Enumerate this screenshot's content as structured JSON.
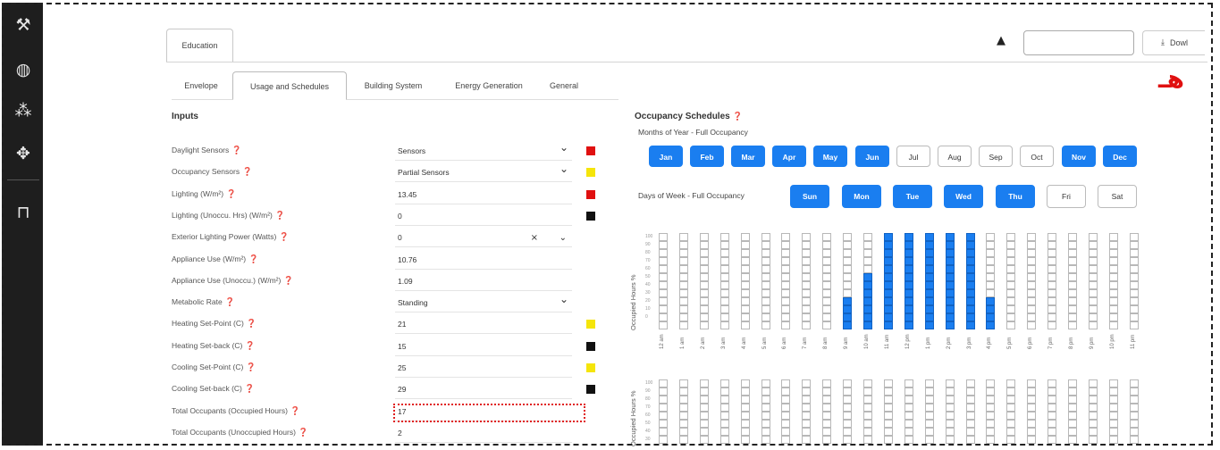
{
  "sidebar": {
    "icons": [
      "tool-icon",
      "globe-icon",
      "network-icon",
      "target-icon",
      "unlock-icon"
    ]
  },
  "top": {
    "tab_label": "Education",
    "search_value": "",
    "download_label": "Dowl",
    "annotation_mark": "هـ"
  },
  "subtabs": [
    {
      "label": "Envelope",
      "active": false
    },
    {
      "label": "Usage and Schedules",
      "active": true
    },
    {
      "label": "Building System",
      "active": false
    },
    {
      "label": "Energy Generation",
      "active": false
    },
    {
      "label": "General",
      "active": false
    }
  ],
  "inputs": {
    "title": "Inputs",
    "rows": [
      {
        "label": "Daylight Sensors",
        "value": "Sensors",
        "type": "select",
        "color": "#e01010"
      },
      {
        "label": "Occupancy Sensors",
        "value": "Partial Sensors",
        "type": "select",
        "color": "#f5e50a"
      },
      {
        "label": "Lighting (W/m²)",
        "value": "13.45",
        "type": "text",
        "color": "#e01010"
      },
      {
        "label": "Lighting (Unoccu. Hrs) (W/m²)",
        "value": "0",
        "type": "text",
        "color": "#111111"
      },
      {
        "label": "Exterior Lighting Power (Watts)",
        "value": "0",
        "type": "clearable",
        "color": ""
      },
      {
        "label": "Appliance Use (W/m²)",
        "value": "10.76",
        "type": "text",
        "color": ""
      },
      {
        "label": "Appliance Use (Unoccu.) (W/m²)",
        "value": "1.09",
        "type": "text",
        "color": ""
      },
      {
        "label": "Metabolic Rate",
        "value": "Standing",
        "type": "select",
        "color": ""
      },
      {
        "label": "Heating Set-Point (C)",
        "value": "21",
        "type": "text",
        "color": "#f5e50a"
      },
      {
        "label": "Heating Set-back (C)",
        "value": "15",
        "type": "text",
        "color": "#111111"
      },
      {
        "label": "Cooling Set-Point (C)",
        "value": "25",
        "type": "text",
        "color": "#f5e50a"
      },
      {
        "label": "Cooling Set-back (C)",
        "value": "29",
        "type": "text",
        "color": "#111111"
      },
      {
        "label": "Total Occupants (Occupied Hours)",
        "value": "17",
        "type": "text",
        "color": ""
      },
      {
        "label": "Total Occupants (Unoccupied Hours)",
        "value": "2",
        "type": "text",
        "color": ""
      }
    ]
  },
  "occupancy": {
    "title": "Occupancy Schedules",
    "months_label": "Months of Year - Full Occupancy",
    "months": [
      {
        "label": "Jan",
        "on": true
      },
      {
        "label": "Feb",
        "on": true
      },
      {
        "label": "Mar",
        "on": true
      },
      {
        "label": "Apr",
        "on": true
      },
      {
        "label": "May",
        "on": true
      },
      {
        "label": "Jun",
        "on": true
      },
      {
        "label": "Jul",
        "on": false
      },
      {
        "label": "Aug",
        "on": false
      },
      {
        "label": "Sep",
        "on": false
      },
      {
        "label": "Oct",
        "on": false
      },
      {
        "label": "Nov",
        "on": true
      },
      {
        "label": "Dec",
        "on": true
      }
    ],
    "days_label": "Days of Week - Full Occupancy",
    "days": [
      {
        "label": "Sun",
        "on": true
      },
      {
        "label": "Mon",
        "on": true
      },
      {
        "label": "Tue",
        "on": true
      },
      {
        "label": "Wed",
        "on": true
      },
      {
        "label": "Thu",
        "on": true
      },
      {
        "label": "Fri",
        "on": false
      },
      {
        "label": "Sat",
        "on": false
      }
    ],
    "chart_ylabel": "Occupied Hours %",
    "hours": [
      "12 am",
      "1 am",
      "2 am",
      "3 am",
      "4 am",
      "5 am",
      "6 am",
      "7 am",
      "8 am",
      "9 am",
      "10 am",
      "11 am",
      "12 pm",
      "1 pm",
      "2 pm",
      "3 pm",
      "4 pm",
      "5 pm",
      "6 pm",
      "7 pm",
      "8 pm",
      "9 pm",
      "10 pm",
      "11 pm"
    ],
    "hourly_percent": [
      0,
      0,
      0,
      0,
      0,
      0,
      0,
      0,
      0,
      30,
      60,
      100,
      100,
      100,
      100,
      100,
      30,
      0,
      0,
      0,
      0,
      0,
      0,
      0
    ]
  },
  "colors": {
    "accent": "#1a7ef0",
    "red": "#e01010",
    "yellow": "#f5e50a",
    "black": "#111111"
  }
}
